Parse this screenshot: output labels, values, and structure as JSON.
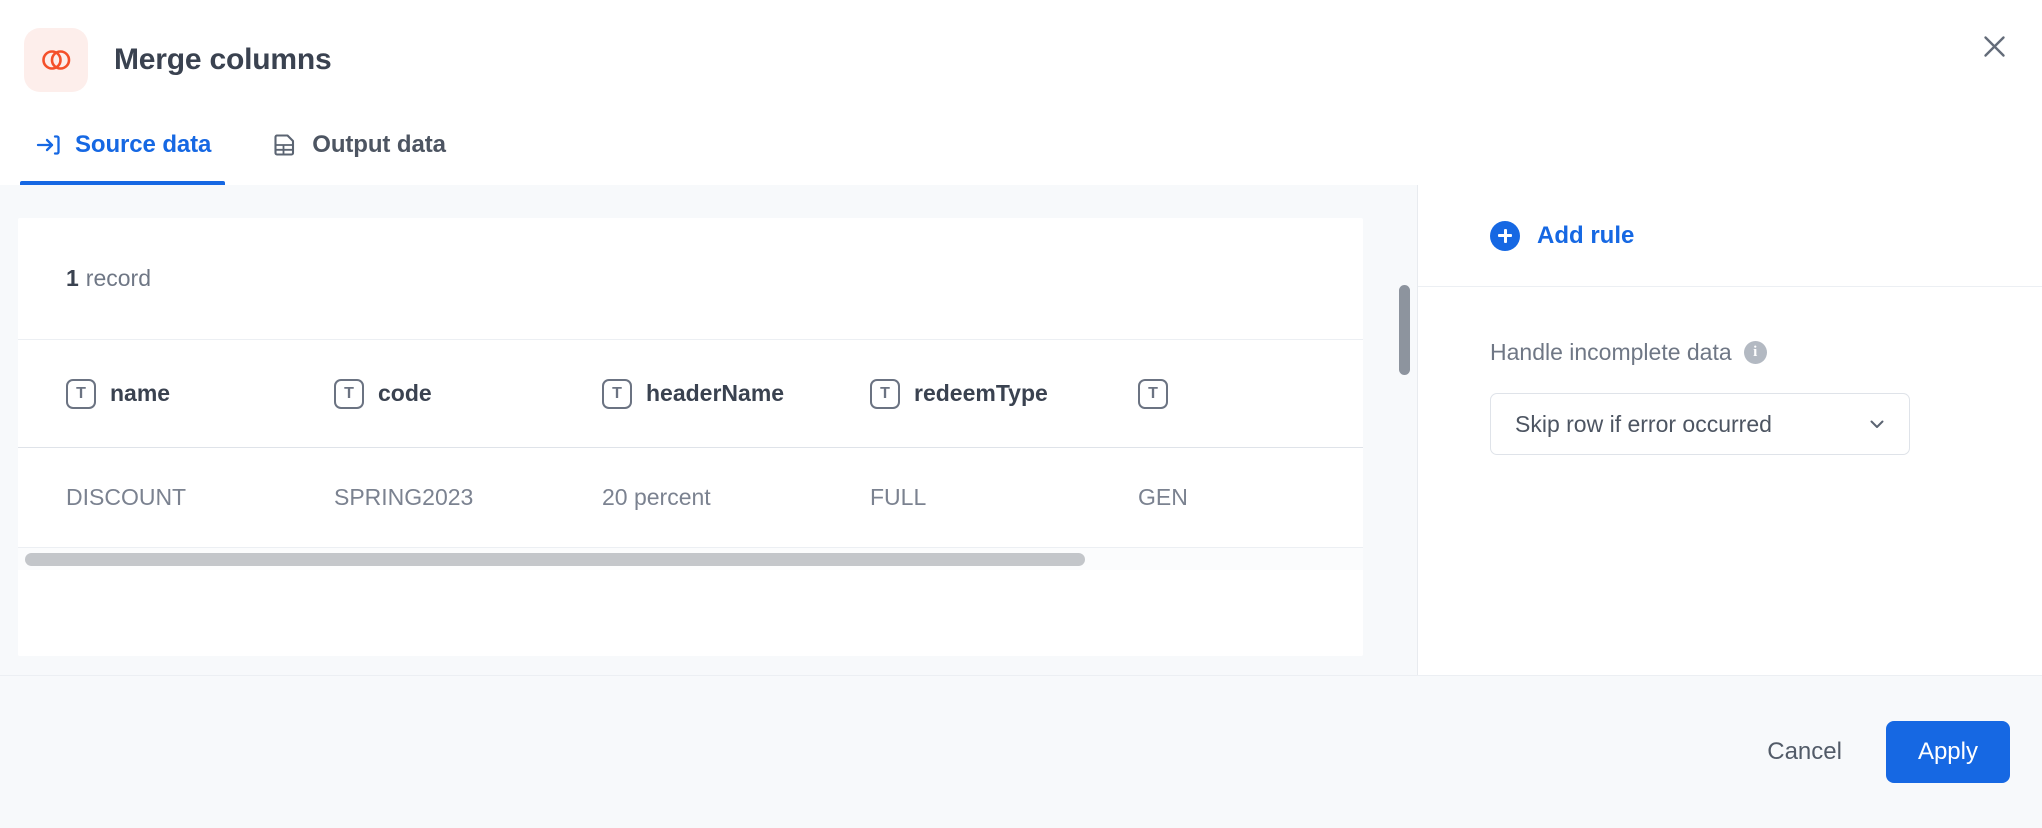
{
  "header": {
    "title": "Merge columns",
    "app_icon": "merge-circles-icon",
    "icon_color": "#f4502a",
    "icon_bg": "#fdeeeb",
    "close_icon": "close-icon"
  },
  "tabs": [
    {
      "label": "Source data",
      "icon": "arrow-into-box-icon",
      "active": true
    },
    {
      "label": "Output data",
      "icon": "document-table-icon",
      "active": false
    }
  ],
  "preview": {
    "record_count_value": "1",
    "record_count_label": "record",
    "columns": [
      {
        "name": "name",
        "type_icon": "text-type-icon",
        "type_glyph": "T"
      },
      {
        "name": "code",
        "type_icon": "text-type-icon",
        "type_glyph": "T"
      },
      {
        "name": "headerName",
        "type_icon": "text-type-icon",
        "type_glyph": "T"
      },
      {
        "name": "redeemType",
        "type_icon": "text-type-icon",
        "type_glyph": "T"
      },
      {
        "name": "",
        "type_icon": "text-type-icon",
        "type_glyph": "T"
      }
    ],
    "rows": [
      [
        "DISCOUNT",
        "SPRING2023",
        "20 percent",
        "FULL",
        "GEN"
      ]
    ]
  },
  "rules_panel": {
    "add_rule_label": "Add rule",
    "add_rule_icon": "plus-circle-icon",
    "setting_label": "Handle incomplete data",
    "info_icon": "info-icon",
    "info_glyph": "i",
    "select_value": "Skip row if error occurred",
    "select_chevron": "chevron-down-icon"
  },
  "footer": {
    "cancel_label": "Cancel",
    "apply_label": "Apply"
  },
  "colors": {
    "accent_blue": "#1668e3",
    "brand_orange": "#f4502a",
    "page_bg": "#f7f9fb",
    "text_dark": "#3a4250",
    "text_muted": "#6f7785"
  }
}
